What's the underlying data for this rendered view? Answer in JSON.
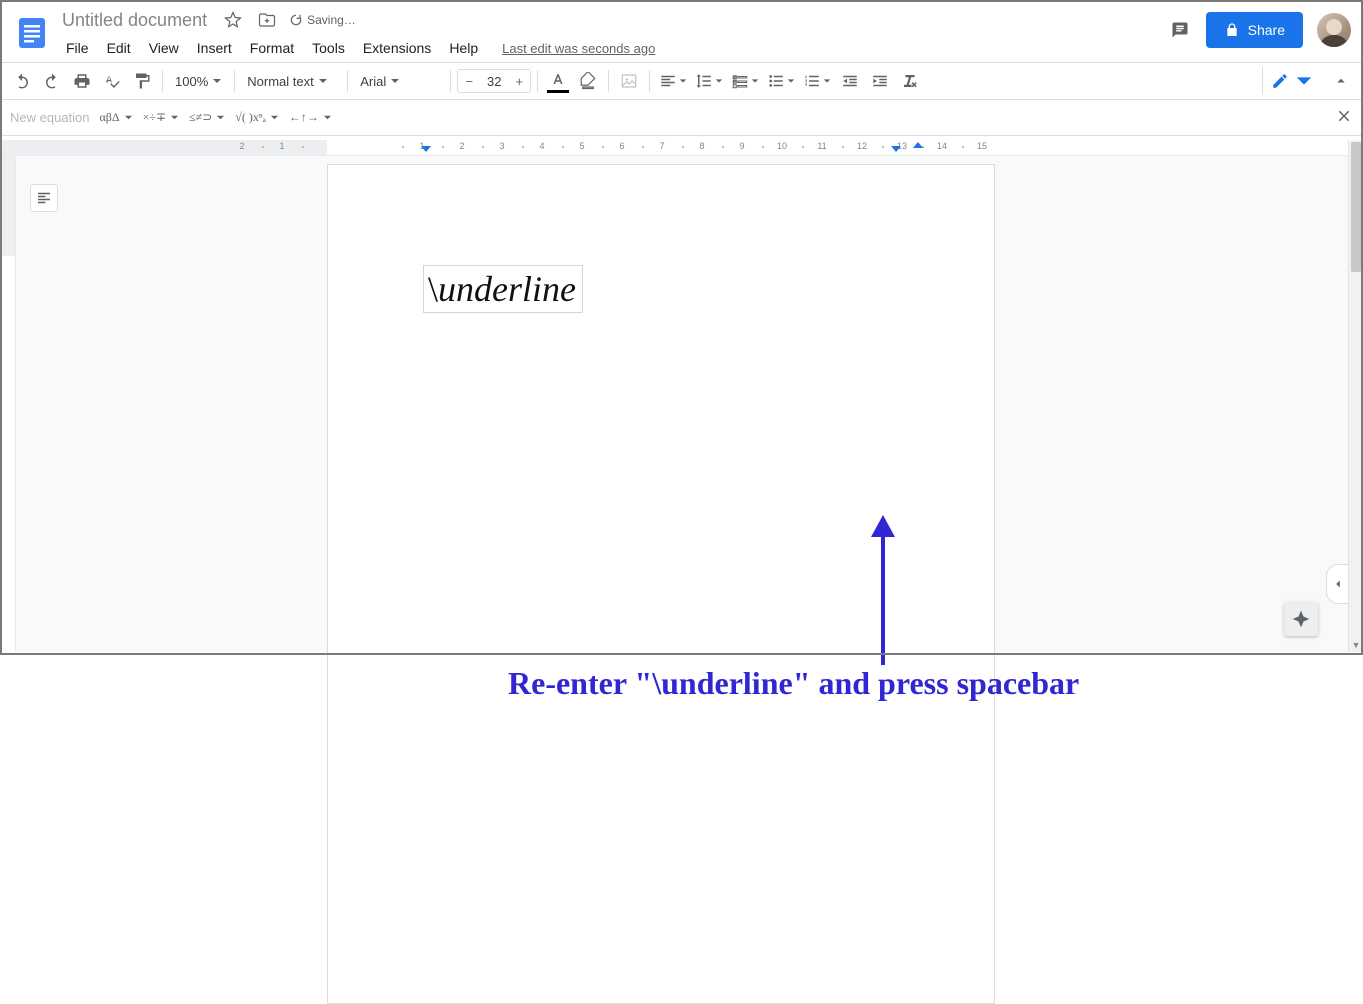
{
  "header": {
    "doc_title": "Untitled document",
    "saving": "Saving…",
    "last_edit": "Last edit was seconds ago",
    "share": "Share"
  },
  "menu": {
    "file": "File",
    "edit": "Edit",
    "view": "View",
    "insert": "Insert",
    "format": "Format",
    "tools": "Tools",
    "extensions": "Extensions",
    "help": "Help"
  },
  "toolbar": {
    "zoom": "100%",
    "style": "Normal text",
    "font": "Arial",
    "font_size": "32"
  },
  "eqbar": {
    "label": "New equation",
    "greek": "αβΔ",
    "ops": "×÷∓",
    "rel": "≤≠⊃",
    "math": "√( )xⁿₐ",
    "arrows": "←↑→"
  },
  "ruler": {
    "left": [
      "2",
      "1"
    ],
    "right": [
      "1",
      "2",
      "3",
      "4",
      "5",
      "6",
      "7",
      "8",
      "9",
      "10",
      "11",
      "12",
      "13",
      "14",
      "15"
    ]
  },
  "document": {
    "equation_text": "underline"
  },
  "annotation": {
    "text": "Re-enter \"\\underline\" and press spacebar"
  }
}
